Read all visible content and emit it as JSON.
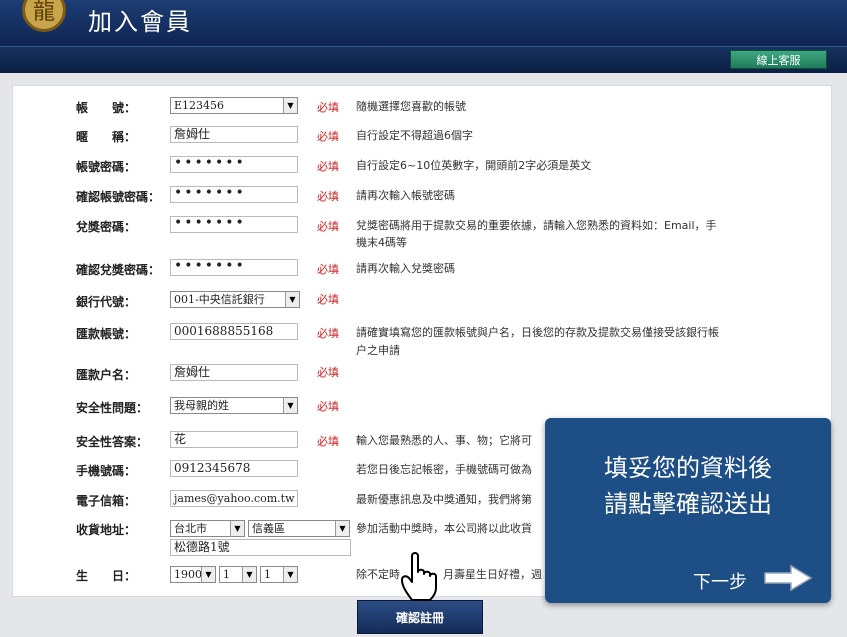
{
  "header": {
    "title": "加入會員",
    "logo_icon": "dragon-emblem-icon"
  },
  "toolbar": {
    "support_label": "線上客服"
  },
  "form": {
    "fields": [
      {
        "label": "帳　　號：",
        "value": "E123456",
        "required": "必填",
        "hint": "隨機選擇您喜歡的帳號"
      },
      {
        "label": "暱　　稱：",
        "value": "詹姆仕",
        "required": "必填",
        "hint": "自行設定不得超過6個字"
      },
      {
        "label": "帳號密碼：",
        "value": "•••••••",
        "required": "必填",
        "hint": "自行設定6~10位英數字，開頭前2字必須是英文"
      },
      {
        "label": "確認帳號密碼：",
        "value": "•••••••",
        "required": "必填",
        "hint": "請再次輸入帳號密碼"
      },
      {
        "label": "兌獎密碼：",
        "value": "•••••••",
        "required": "必填",
        "hint": "兌獎密碼將用于提款交易的重要依據，請輸入您熟悉的資料如：Email，手",
        "hint2": "機末4碼等"
      },
      {
        "label": "確認兌獎密碼：",
        "value": "•••••••",
        "required": "必填",
        "hint": "請再次輸入兌獎密碼"
      },
      {
        "label": "銀行代號：",
        "value": "001-中央信託銀行",
        "required": "必填",
        "hint": ""
      },
      {
        "label": "匯款帳號：",
        "value": "0001688855168",
        "required": "必填",
        "hint": "請確實填寫您的匯款帳號與户名，日後您的存款及提款交易僅接受該銀行帳",
        "hint2": "户之申請"
      },
      {
        "label": "匯款户名：",
        "value": "詹姆仕",
        "required": "必填",
        "hint": ""
      },
      {
        "label": "安全性問題：",
        "value": "我母親的姓",
        "required": "必填",
        "hint": ""
      },
      {
        "label": "安全性答案：",
        "value": "花",
        "required": "必填",
        "hint": "輸入您最熟悉的人、事、物；它將可"
      },
      {
        "label": "手機號碼：",
        "value": "0912345678",
        "required": "",
        "hint": "若您日後忘記帳密，手機號碼可做為"
      },
      {
        "label": "電子信箱：",
        "value": "james@yahoo.com.tw",
        "required": "",
        "hint": "最新優惠訊息及中獎通知，我們將第"
      },
      {
        "label": "收貨地址：",
        "city": "台北市",
        "district": "信義區",
        "street": "松德路1號",
        "required": "",
        "hint": "參加活動中獎時，本公司將以此收貨"
      },
      {
        "label": "生　　日：",
        "year": "1900",
        "month": "1",
        "day": "1",
        "required": "",
        "hint": "除不定時",
        "hint_b": "月壽星生日好禮，週"
      }
    ]
  },
  "overlay": {
    "line1": "填妥您的資料後",
    "line2": "請點擊確認送出",
    "next_label": "下一步"
  },
  "submit": {
    "label": "確認註冊"
  },
  "colors": {
    "header": "#1d3d74",
    "required": "#d21e1e",
    "overlay": "#1d4e86",
    "support": "#2d946c"
  }
}
